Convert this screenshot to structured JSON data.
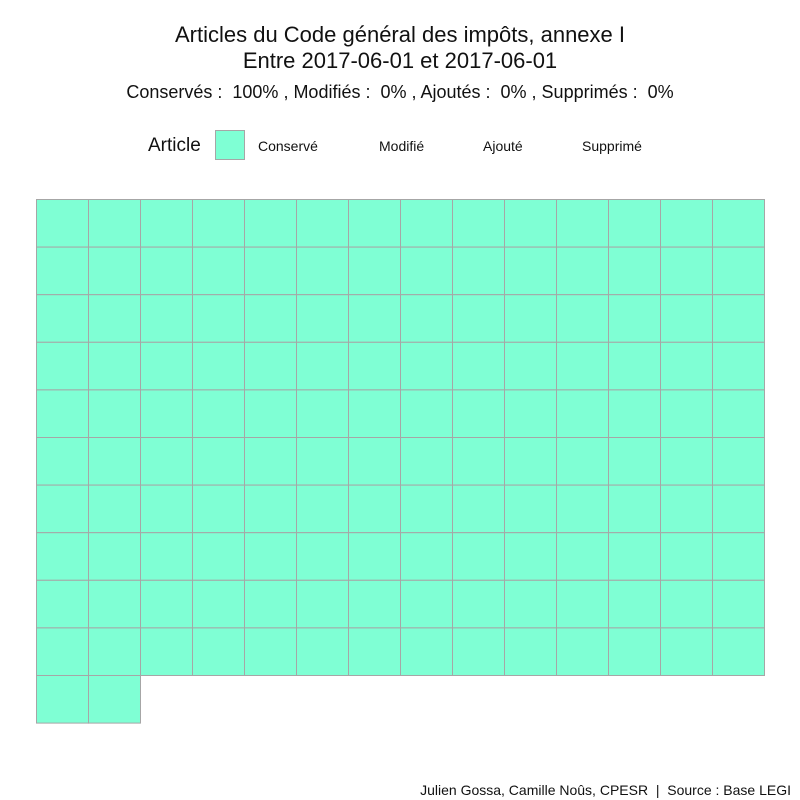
{
  "chart_data": {
    "type": "waffle",
    "title": "Articles du Code général des impôts, annexe I",
    "subtitle": "Entre 2017-06-01 et 2017-06-01",
    "summary": "Conservés :  100% , Modifiés :  0% , Ajoutés :  0% , Supprimés :  0%",
    "legend": {
      "title": "Article",
      "items": [
        {
          "label": "Conservé",
          "color": "#7fffd4"
        },
        {
          "label": "Modifié",
          "color": ""
        },
        {
          "label": "Ajouté",
          "color": ""
        },
        {
          "label": "Supprimé",
          "color": ""
        }
      ]
    },
    "categories": [
      "Conservé",
      "Modifié",
      "Ajouté",
      "Supprimé"
    ],
    "values": [
      142,
      0,
      0,
      0
    ],
    "columns": 14,
    "cell_color": "#7fffd4",
    "cell_border_color": "#a6a6a6"
  },
  "caption": "Julien Gossa, Camille Noûs, CPESR  |  Source : Base LEGI"
}
